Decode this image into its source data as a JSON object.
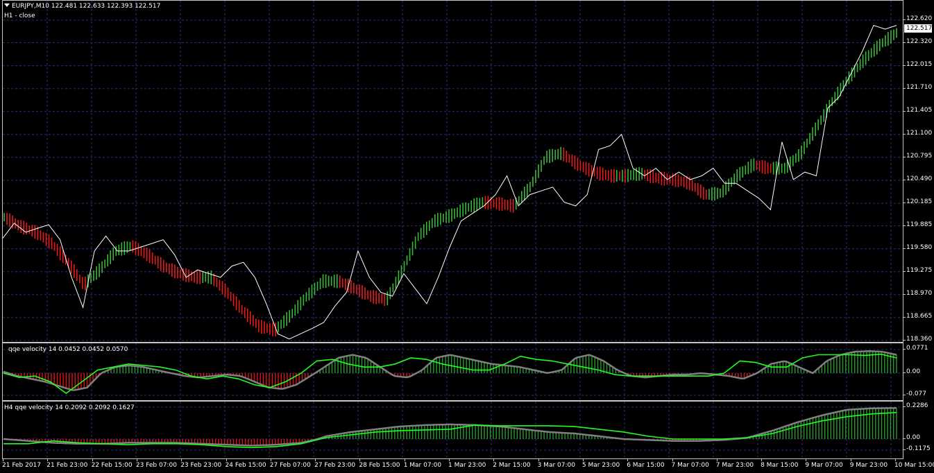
{
  "main": {
    "title": "EURJPY,M10  122.481 122.633 122.393 122.517",
    "subtitle": "H1 - close",
    "price_label": "122.517",
    "axis_ticks": [
      "122.620",
      "122.320",
      "122.015",
      "121.710",
      "121.405",
      "121.100",
      "120.795",
      "120.490",
      "120.185",
      "119.885",
      "119.580",
      "119.275",
      "118.970",
      "118.665",
      "118.360"
    ]
  },
  "sub1": {
    "title": "qqe velocity 14 0.0452 0.0452 0.0570",
    "axis_ticks": [
      "0.0771",
      "0.00",
      "-0.077"
    ]
  },
  "sub2": {
    "title": "H4  qqe velocity 14 0.2092 0.2092 0.1627",
    "axis_ticks": [
      "0.2286",
      "0.00",
      "-0.1175"
    ]
  },
  "time_axis": [
    "21 Feb 2017",
    "21 Feb 23:00",
    "22 Feb 15:00",
    "23 Feb 07:00",
    "23 Feb 23:00",
    "24 Feb 15:00",
    "27 Feb 07:00",
    "27 Feb 23:00",
    "28 Feb 15:00",
    "1 Mar 07:00",
    "1 Mar 23:00",
    "2 Mar 15:00",
    "3 Mar 07:00",
    "5 Mar 23:00",
    "6 Mar 15:00",
    "7 Mar 07:00",
    "7 Mar 23:00",
    "8 Mar 15:00",
    "9 Mar 07:00",
    "9 Mar 23:00",
    "10 Mar 15:00"
  ],
  "colors": {
    "up": "#3cb83c",
    "down": "#e81c1c",
    "signal": "#20ff20",
    "grid": "#2c2c7c",
    "close_line": "#ffffff",
    "hist_outline": "#808080"
  },
  "chart_data": {
    "type": "line",
    "price_ylim": [
      118.36,
      122.62
    ],
    "close_series": [
      119.72,
      119.92,
      119.8,
      119.85,
      119.9,
      119.7,
      119.2,
      118.8,
      119.55,
      119.75,
      119.55,
      119.55,
      119.6,
      119.65,
      119.7,
      119.5,
      119.2,
      119.3,
      119.25,
      119.2,
      119.35,
      119.4,
      119.2,
      118.85,
      118.45,
      118.38,
      118.45,
      118.52,
      118.6,
      118.82,
      119.0,
      119.55,
      119.2,
      119.0,
      118.95,
      119.25,
      119.05,
      118.85,
      119.2,
      119.6,
      119.95,
      120.05,
      120.15,
      120.3,
      120.55,
      120.15,
      120.3,
      120.35,
      120.4,
      120.2,
      120.15,
      120.3,
      120.9,
      120.95,
      121.1,
      120.65,
      120.55,
      120.65,
      120.5,
      120.6,
      120.5,
      120.55,
      120.65,
      120.45,
      120.45,
      120.35,
      120.25,
      120.1,
      121.0,
      120.5,
      120.6,
      120.55,
      121.45,
      121.6,
      121.9,
      122.2,
      122.55,
      122.5,
      122.55
    ],
    "signal_series": [
      120.0,
      119.88,
      119.8,
      119.65,
      119.4,
      119.1,
      119.3,
      119.55,
      119.62,
      119.5,
      119.35,
      119.25,
      119.2,
      119.2,
      119.0,
      118.75,
      118.55,
      118.5,
      118.7,
      118.95,
      119.15,
      119.15,
      119.05,
      118.95,
      118.9,
      119.3,
      119.75,
      119.95,
      120.02,
      120.12,
      120.2,
      120.18,
      120.15,
      120.4,
      120.8,
      120.85,
      120.7,
      120.6,
      120.55,
      120.55,
      120.58,
      120.52,
      120.5,
      120.45,
      120.3,
      120.32,
      120.55,
      120.7,
      120.65,
      120.65,
      120.85,
      121.2,
      121.55,
      121.85,
      122.1,
      122.3,
      122.45
    ],
    "sub1_ylim": [
      -0.077,
      0.0771
    ],
    "sub1_hist": [
      0.005,
      -0.01,
      -0.02,
      -0.03,
      -0.045,
      -0.06,
      -0.05,
      0.0,
      0.02,
      0.025,
      0.02,
      0.01,
      0.0,
      -0.01,
      -0.015,
      -0.01,
      -0.005,
      -0.01,
      -0.03,
      -0.05,
      -0.055,
      -0.04,
      -0.01,
      0.02,
      0.05,
      0.06,
      0.05,
      0.02,
      -0.01,
      -0.015,
      0.01,
      0.05,
      0.06,
      0.05,
      0.04,
      0.03,
      0.025,
      0.02,
      0.01,
      0.0,
      0.01,
      0.05,
      0.06,
      0.04,
      0.01,
      -0.01,
      -0.015,
      -0.01,
      -0.005,
      -0.005,
      0.0,
      -0.005,
      -0.01,
      -0.02,
      0.0,
      0.03,
      0.04,
      0.02,
      0.0,
      0.04,
      0.06,
      0.07,
      0.072,
      0.07,
      0.06
    ],
    "sub1_signal": [
      0.0,
      -0.015,
      -0.01,
      -0.03,
      -0.07,
      -0.03,
      0.01,
      0.02,
      0.03,
      0.025,
      0.02,
      0.01,
      -0.01,
      -0.02,
      -0.01,
      -0.02,
      -0.04,
      -0.05,
      -0.03,
      0.0,
      0.04,
      0.045,
      0.03,
      0.02,
      0.02,
      0.03,
      0.05,
      0.045,
      0.03,
      0.02,
      0.01,
      0.01,
      0.03,
      0.055,
      0.045,
      0.04,
      0.03,
      0.02,
      0.01,
      -0.005,
      -0.01,
      -0.01,
      -0.01,
      -0.01,
      -0.01,
      -0.01,
      0.0,
      0.04,
      0.035,
      0.02,
      0.02,
      0.05,
      0.06,
      0.06,
      0.06,
      0.058,
      0.062,
      0.05
    ],
    "sub2_ylim": [
      -0.1175,
      0.2286
    ],
    "sub2_hist": [
      0.0,
      -0.02,
      -0.04,
      -0.05,
      -0.05,
      -0.04,
      -0.04,
      -0.04,
      -0.05,
      -0.06,
      -0.07,
      -0.06,
      -0.04,
      0.02,
      0.05,
      0.07,
      0.09,
      0.1,
      0.105,
      0.1,
      0.09,
      0.07,
      0.05,
      0.04,
      0.02,
      0.0,
      -0.01,
      -0.02,
      -0.02,
      -0.01,
      0.01,
      0.06,
      0.12,
      0.17,
      0.21,
      0.22,
      0.222
    ],
    "sub2_signal": [
      -0.05,
      -0.05,
      -0.02,
      -0.04,
      -0.05,
      -0.06,
      -0.05,
      -0.05,
      -0.06,
      -0.08,
      -0.09,
      -0.08,
      -0.05,
      0.01,
      0.03,
      0.05,
      0.06,
      0.065,
      0.07,
      0.1,
      0.095,
      0.095,
      0.095,
      0.09,
      0.07,
      0.05,
      0.02,
      0.0,
      0.0,
      0.0,
      0.01,
      0.04,
      0.09,
      0.13,
      0.16,
      0.18,
      0.19
    ]
  }
}
